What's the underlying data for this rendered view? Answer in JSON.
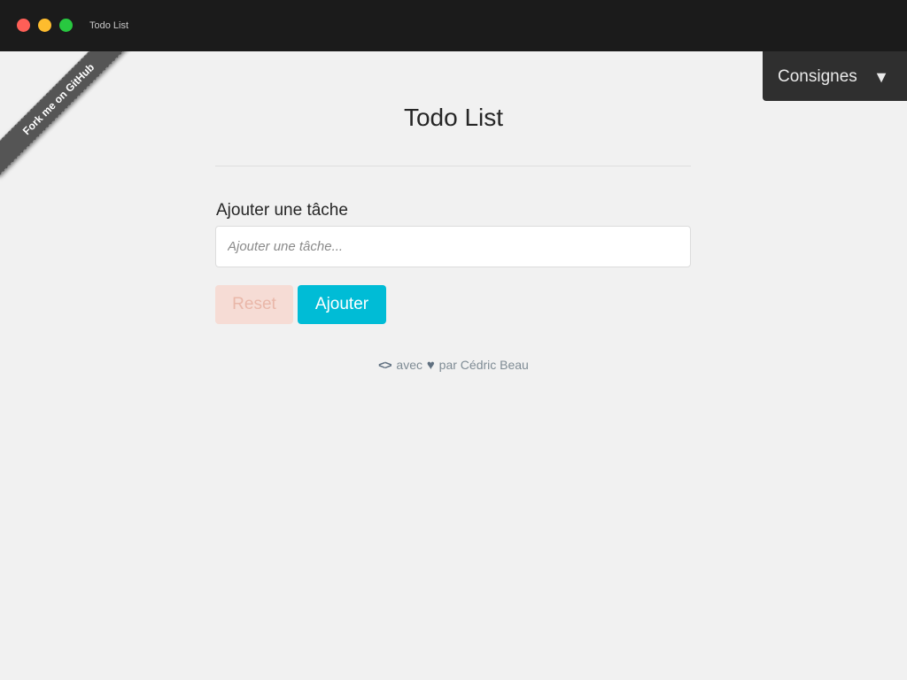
{
  "window": {
    "title": "Todo List"
  },
  "ribbon": {
    "label": "Fork me on GitHub"
  },
  "consignes": {
    "label": "Consignes",
    "caret": "▼"
  },
  "main": {
    "title": "Todo List",
    "form": {
      "label": "Ajouter une tâche",
      "input_value": "",
      "input_placeholder": "Ajouter une tâche..."
    },
    "buttons": {
      "reset_label": "Reset",
      "add_label": "Ajouter"
    }
  },
  "footer": {
    "code_icon": "<>",
    "text_with": "avec",
    "heart_icon": "♥",
    "text_by": "par Cédric Beau"
  },
  "colors": {
    "accent": "#00bcd6",
    "reset_bg": "#f6dcd5",
    "titlebar": "#1b1b1b",
    "dropdown_bg": "#2f2f2f"
  }
}
